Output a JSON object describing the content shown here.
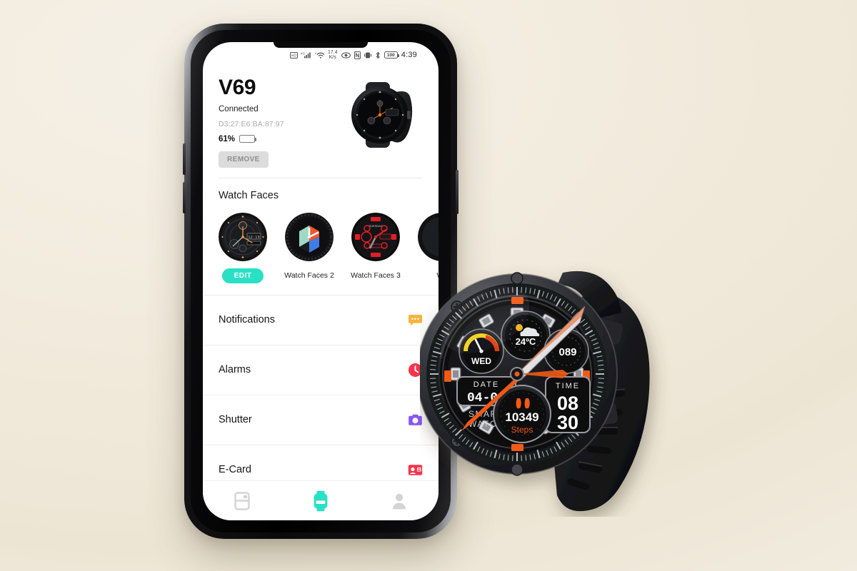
{
  "background": {
    "color_top": "#f5f0e6",
    "color_bottom": "#f3eee3"
  },
  "phone": {
    "statusbar": {
      "icons_left": [
        "hd-icon",
        "signal-4g-icon",
        "wifi-icon"
      ],
      "network_speed_value": "17.4",
      "network_speed_unit": "K/s",
      "icons_right": [
        "eye-icon",
        "nfc-icon",
        "vibrate-alarm-icon",
        "bluetooth-icon"
      ],
      "battery_level": "100",
      "time": "4:39"
    },
    "device": {
      "name": "V69",
      "status": "Connected",
      "mac_address": "D3:27:E6:BA:87:97",
      "battery_percent_label": "61%",
      "battery_percent_value": 61,
      "remove_label": "REMOVE",
      "thumbnail_name": "v69-smartwatch-product-image"
    },
    "watch_faces": {
      "section_title": "Watch Faces",
      "edit_label": "EDIT",
      "items": [
        {
          "label": "",
          "name": "watch-face-1-skeleton-orange",
          "selected": true
        },
        {
          "label": "Watch Faces 2",
          "name": "watch-face-2-color-cube",
          "selected": false
        },
        {
          "label": "Watch Faces 3",
          "name": "watch-face-3-red-tactical",
          "selected": false
        },
        {
          "label": "Wa",
          "name": "watch-face-4-partial",
          "selected": false
        }
      ]
    },
    "menu": {
      "items": [
        {
          "label": "Notifications",
          "icon": "chat-bubble-icon",
          "color": "#f9b33a"
        },
        {
          "label": "Alarms",
          "icon": "clock-icon",
          "color": "#f8344b"
        },
        {
          "label": "Shutter",
          "icon": "camera-icon",
          "color": "#8a54f5"
        },
        {
          "label": "E-Card",
          "icon": "card-icon",
          "color": "#f8344b"
        }
      ]
    },
    "bottom_nav": {
      "items": [
        {
          "name": "nav-device-card",
          "icon": "card-list-icon",
          "active": false
        },
        {
          "name": "nav-watch",
          "icon": "smartwatch-icon",
          "active": true
        },
        {
          "name": "nav-profile",
          "icon": "person-icon",
          "active": false
        }
      ],
      "active_color": "#2ae0c4",
      "inactive_color": "#d4d4d4"
    }
  },
  "watch_product": {
    "name": "v69-smartwatch-hero-photo",
    "face": {
      "weather_temp": "24ºC",
      "weekday": "WED",
      "right_counter": "089",
      "date_label": "DATE",
      "date_value": "04-06",
      "time_label": "TIME",
      "time_hours": "08",
      "time_minutes": "30",
      "steps_value": "10349",
      "steps_label": "Steps",
      "brand_line1": "SMART",
      "brand_line2": "WATCH"
    }
  }
}
